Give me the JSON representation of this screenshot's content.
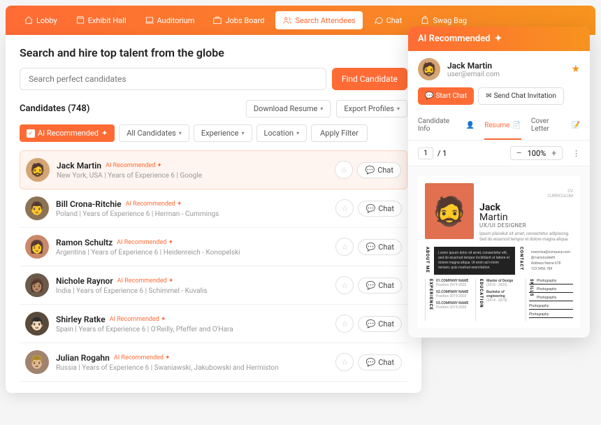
{
  "nav": {
    "lobby": "Lobby",
    "exhibit": "Exhibit Hall",
    "auditorium": "Auditorium",
    "jobs": "Jobs Board",
    "search": "Search Attendees",
    "chat": "Chat",
    "swag": "Swag Bag"
  },
  "page": {
    "title": "Search and hire top talent from the globe",
    "search_placeholder": "Search perfect candidates",
    "find_btn": "Find Candidate"
  },
  "candidates_header": {
    "title": "Candidates (748)",
    "download": "Download Resume",
    "export": "Export Profiles"
  },
  "filters": {
    "ai_recommended": "AI Recommended",
    "all_candidates": "All Candidates",
    "experience": "Experience",
    "location": "Location",
    "apply": "Apply Filter"
  },
  "ai_tag": "AI Recommended",
  "chat_label": "Chat",
  "candidates": [
    {
      "name": "Jack Martin",
      "meta": "New York, USA  |  Years of Experience 6  |  Google",
      "selected": true,
      "avatar_bg": "#d4a574"
    },
    {
      "name": "Bill Crona-Ritchie",
      "meta": "Poland  |  Years of Experience 6  |  Herman - Cummings",
      "avatar_bg": "#8b7355"
    },
    {
      "name": "Ramon Schultz",
      "meta": "Argentina  |  Years of Experience 6  |  Heidenreich - Konopelski",
      "avatar_bg": "#c9896a"
    },
    {
      "name": "Nichole Raynor",
      "meta": "India  |  Years of Experience 6  |  Schimmel - Kuvalis",
      "avatar_bg": "#6b5a4a"
    },
    {
      "name": "Shirley Ratke",
      "meta": "Spain  |  Years of Experience 6  |  O'Reilly, Pfeffer and O'Hara",
      "avatar_bg": "#5a4a3a"
    },
    {
      "name": "Julian Rogahn",
      "meta": "Russia  |  Years of Experience 6  |  Swaniawski, Jakubowski and Hermiston",
      "avatar_bg": "#a0826d"
    }
  ],
  "panel": {
    "header": "AI Recommended",
    "name": "Jack Martin",
    "email": "user@email.com",
    "start_chat": "Start Chat",
    "send_invite": "Send Chat Invitation",
    "tabs": {
      "info": "Candidate Info",
      "resume": "Resume",
      "cover": "Cover Letter"
    },
    "pdf": {
      "page": "1",
      "total": "/  1",
      "zoom": "100%"
    }
  },
  "resume": {
    "first": "Jack",
    "last": "Martin",
    "role": "UX/UI DESIGNER",
    "bio": "Ipsum placekut sit amet, consectetur adipiscing. Sed do eiusmod tempor et dolore magna aliqua.",
    "about_label": "ABOUT ME",
    "about": "Lorem ipsum dolor sit amet, consectetur elit, sed do eiusmod tempor incididunt ut labore et dolore magna aliqua. Ut enim ad minim veniam, quis nostrud exercitation.",
    "contact_label": "CONTACT",
    "contact": {
      "email": "marynixa@company.com",
      "handle": "@marynizabeth",
      "address": "Address Name 678",
      "phone": "123 3456 789"
    },
    "experience_label": "EXPERIENCE",
    "experience": [
      {
        "title": "01.COMPANY NAME",
        "sub": "Position 2019-2020"
      },
      {
        "title": "02.COMPANY NAME",
        "sub": "Position 2019-2020"
      },
      {
        "title": "03.COMPANY NAME",
        "sub": "Position 2019-2020"
      }
    ],
    "education_label": "EDUCATION",
    "education": [
      {
        "title": "Master of Design",
        "sub": "(2018 - 2020)"
      },
      {
        "title": "Bachelor of engineering",
        "sub": "(2014 - 2018)"
      }
    ],
    "skills_label": "SKILLS",
    "skills": [
      "Photography",
      "Photography",
      "Photography",
      "Photography",
      "Photography"
    ]
  }
}
